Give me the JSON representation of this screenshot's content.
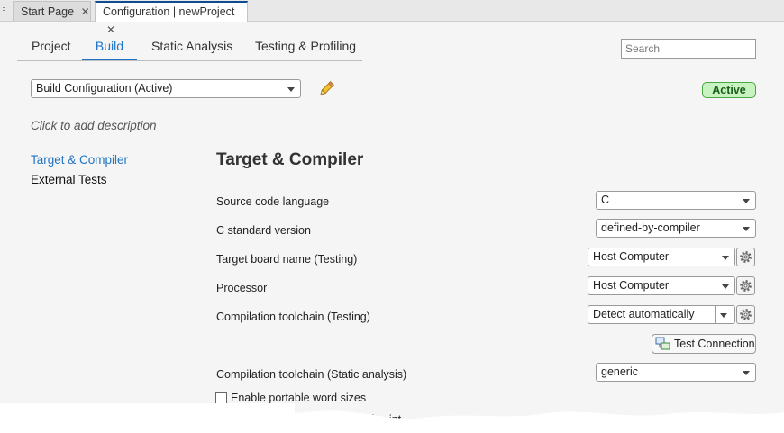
{
  "tabs": [
    {
      "label": "Start Page",
      "close": "✕"
    },
    {
      "label": "Configuration | newProject",
      "close": "✕"
    }
  ],
  "nav": {
    "items": [
      "Project",
      "Build",
      "Static Analysis",
      "Testing & Profiling"
    ],
    "active": "Build"
  },
  "search": {
    "placeholder": "Search"
  },
  "build_config": {
    "value": "Build Configuration (Active)",
    "status": "Active"
  },
  "description_placeholder": "Click to add description",
  "sidebar": {
    "items": [
      "Target & Compiler",
      "External Tests"
    ],
    "active": "Target & Compiler"
  },
  "section": {
    "title": "Target & Compiler",
    "fields": [
      {
        "label": "Source code language",
        "value": "C"
      },
      {
        "label": "C standard version",
        "value": "defined-by-compiler"
      },
      {
        "label": "Target board name (Testing)",
        "value": "Host Computer"
      },
      {
        "label": "Processor",
        "value": "Host Computer"
      },
      {
        "label": "Compilation toolchain (Testing)",
        "value": "Detect automatically"
      },
      {
        "label": "Compilation toolchain (Static analysis)",
        "value": "generic"
      }
    ],
    "test_connection_label": "Test Connection",
    "checkbox_label": "Enable portable word sizes",
    "partial_label": "results of negative int",
    "checkbox_checked": false
  },
  "colors": {
    "accent": "#1f74c4",
    "active_badge_bg": "#c8f2c0",
    "active_badge_border": "#4aa543",
    "tab_active_top": "#0e4c8f"
  }
}
